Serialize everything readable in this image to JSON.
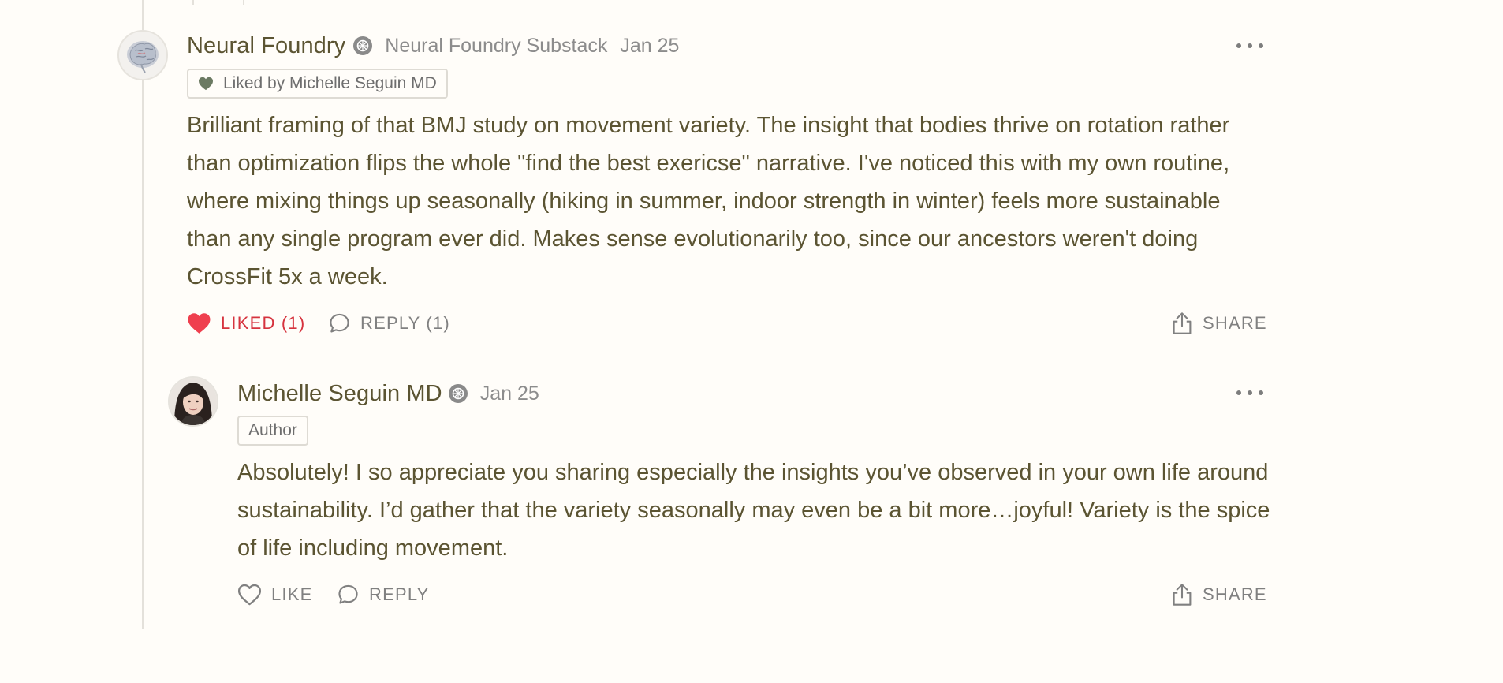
{
  "comments": [
    {
      "author": "Neural Foundry",
      "publication": "Neural Foundry Substack",
      "date": "Jan 25",
      "liked_by_badge": "Liked by Michelle Seguin MD",
      "body": "Brilliant framing of that BMJ study on movement variety. The insight that bodies thrive on rotation rather than optimization flips the whole \"find the best exericse\" narrative. I've noticed this with my own routine, where mixing things up seasonally (hiking in summer, indoor strength in winter) feels more sustainable than any single program ever did. Makes sense evolutionarily too, since our ancestors weren't doing CrossFit 5x a week.",
      "actions": {
        "like_label": "LIKED (1)",
        "reply_label": "REPLY (1)",
        "share_label": "SHARE"
      },
      "liked": true
    },
    {
      "author": "Michelle Seguin MD",
      "date": "Jan 25",
      "role_badge": "Author",
      "body": "Absolutely! I so appreciate you sharing especially the insights you’ve observed in your own life around sustainability. I’d gather that the variety seasonally may even be a bit more…joyful! Variety is the spice of life including movement.",
      "actions": {
        "like_label": "LIKE",
        "reply_label": "REPLY",
        "share_label": "SHARE"
      },
      "liked": false
    }
  ],
  "colors": {
    "background": "#fffdf9",
    "text": "#5b5432",
    "muted": "#8c8c8c",
    "liked": "#d6333e",
    "heart_badge": "#6b7a62"
  },
  "icons": {
    "verified": "verified-badge-icon",
    "heart_filled": "heart-filled-icon",
    "heart_outline": "heart-outline-icon",
    "reply": "speech-bubble-icon",
    "share": "share-upload-icon",
    "more": "ellipsis-icon"
  }
}
